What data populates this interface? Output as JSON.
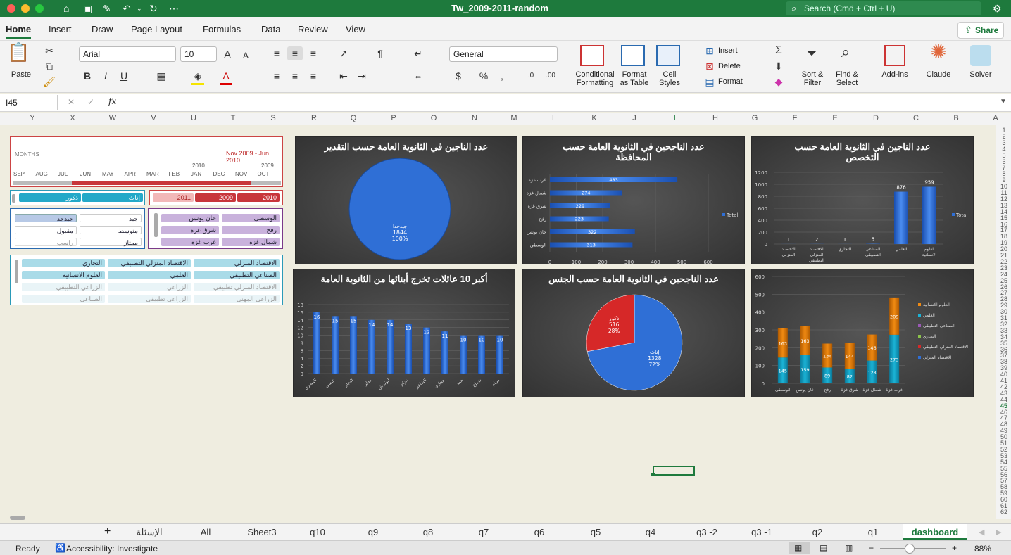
{
  "window": {
    "title": "Tw_2009-2011-random",
    "search_placeholder": "Search (Cmd + Ctrl + U)"
  },
  "tabs": [
    "Home",
    "Insert",
    "Draw",
    "Page Layout",
    "Formulas",
    "Data",
    "Review",
    "View"
  ],
  "share_label": "Share",
  "ribbon": {
    "paste": "Paste",
    "font": "Arial",
    "size": "10",
    "number_format": "General",
    "cond": "Conditional\nFormatting",
    "format_table": "Format\nas Table",
    "cell_styles": "Cell\nStyles",
    "insert": "Insert",
    "delete": "Delete",
    "format": "Format",
    "sort": "Sort &\nFilter",
    "find": "Find &\nSelect",
    "addins": "Add-ins",
    "claude": "Claude",
    "solver": "Solver"
  },
  "formula_bar": {
    "cell_ref": "I45",
    "fx": "fx"
  },
  "columns": [
    "Y",
    "X",
    "W",
    "V",
    "U",
    "T",
    "S",
    "R",
    "Q",
    "P",
    "O",
    "N",
    "M",
    "L",
    "K",
    "J",
    "I",
    "H",
    "G",
    "F",
    "E",
    "D",
    "C",
    "B",
    "A"
  ],
  "rows": [
    "1",
    "2",
    "3",
    "4",
    "5",
    "6",
    "7",
    "8",
    "9",
    "10",
    "11",
    "12",
    "13",
    "14",
    "15",
    "16",
    "17",
    "18",
    "19",
    "20",
    "21",
    "22",
    "23",
    "24",
    "25",
    "26",
    "27",
    "28",
    "29",
    "30",
    "31",
    "32",
    "33",
    "34",
    "35",
    "36",
    "37",
    "38",
    "39",
    "40",
    "41",
    "42",
    "43",
    "44",
    "45",
    "46",
    "47",
    "48",
    "49",
    "50",
    "51",
    "52",
    "53",
    "54",
    "55",
    "56",
    "57",
    "58",
    "59",
    "60",
    "61",
    "62"
  ],
  "timeline": {
    "label": "MONTHS",
    "range": "Nov 2009 - Jun 2010",
    "year_2010": "2010",
    "year_2009": "2009",
    "months": [
      "SEP",
      "AUG",
      "JUL",
      "JUN",
      "MAY",
      "APR",
      "MAR",
      "FEB",
      "JAN",
      "DEC",
      "NOV",
      "OCT"
    ]
  },
  "slicer_gender": [
    "إناث",
    "ذكور"
  ],
  "slicer_year": [
    "2011",
    "2009",
    "2010"
  ],
  "slicer_grade": [
    "جيدجدا",
    "جيد",
    "متوسط",
    "مقبول",
    "ممتاز",
    "راسب"
  ],
  "slicer_gov": [
    "الوسطى",
    "خان يونس",
    "رفح",
    "شرق غزة",
    "شمال غزة",
    "غرب غزة"
  ],
  "slicer_spec": [
    "الاقتصاد المنزلي",
    "الاقتصاد المنزلي التطبيقي",
    "التجاري",
    "الصناعي التطبيقي",
    "العلمي",
    "العلوم الانسانية",
    "الاقتصاد المنزلي تطبيقي",
    "الزراعي",
    "الزراعي التطبيقي",
    "الزراعي المهني",
    "الزراعي تطبيقي",
    "الصناعي"
  ],
  "chart_data": [
    {
      "id": "grade",
      "type": "pie",
      "title": "عدد الناجين في الثانوية العامة حسب التقدير",
      "categories": [
        "جيدجدا"
      ],
      "values": [
        1844
      ],
      "labels": [
        "1844",
        "100%"
      ],
      "colors": [
        "#2f6fd6"
      ]
    },
    {
      "id": "gov",
      "type": "bar",
      "title": "عدد الناجحين في الثانوية العامة حسب المحافظة",
      "categories": [
        "غرب غزة",
        "شمال غزة",
        "شرق غزة",
        "رفح",
        "خان يونس",
        "الوسطى"
      ],
      "values": [
        483,
        274,
        229,
        223,
        322,
        313
      ],
      "xlim": [
        0,
        600
      ],
      "xticks": [
        "0",
        "100",
        "200",
        "300",
        "400",
        "500",
        "600"
      ],
      "legend": "Total"
    },
    {
      "id": "spec",
      "type": "bar",
      "title": "عدد الناجين في الثانوية العامة حسب التخصص",
      "categories": [
        "الاقتصاد المنزلي",
        "الاقتصاد المنزلي التطبيقي",
        "التجاري",
        "الصناعي التطبيقي",
        "العلمي",
        "العلوم الانسانية"
      ],
      "values": [
        1,
        2,
        1,
        5,
        876,
        959
      ],
      "ylim": [
        0,
        1200
      ],
      "yticks": [
        "0",
        "200",
        "400",
        "600",
        "800",
        "1000",
        "1200"
      ],
      "legend": "Total"
    },
    {
      "id": "families",
      "type": "bar",
      "title": "أكبر 10 عائلات تخرج أبنائها من الثانوية العامة",
      "categories": [
        "المصري",
        "عيسى",
        "النجار",
        "مطر",
        "أبوكرش",
        "عزام",
        "الشاعر",
        "حجازي",
        "حمد",
        "شملخ",
        "صيام"
      ],
      "values": [
        16,
        15,
        15,
        14,
        14,
        13,
        12,
        11,
        10,
        10,
        10
      ],
      "ylim": [
        0,
        18
      ],
      "yticks": [
        "0",
        "2",
        "4",
        "6",
        "8",
        "10",
        "12",
        "14",
        "16",
        "18"
      ]
    },
    {
      "id": "gender",
      "type": "pie",
      "title": "عدد الناجحين في الثانوية العامة حسب الجنس",
      "categories": [
        "إناث",
        "ذكور"
      ],
      "values": [
        1328,
        516
      ],
      "labels": [
        [
          "إناث",
          "1328",
          "72%"
        ],
        [
          "ذكور",
          "516",
          "28%"
        ]
      ],
      "colors": [
        "#2f6fd6",
        "#d62828"
      ]
    },
    {
      "id": "stacked",
      "type": "bar",
      "title": "",
      "categories": [
        "الوسطى",
        "خان يونس",
        "رفح",
        "شرق غزة",
        "شمال غزة",
        "غرب غزة"
      ],
      "series": [
        {
          "name": "العلمي",
          "values": [
            145,
            159,
            89,
            82,
            128,
            273
          ],
          "color": "#1bb3d6"
        },
        {
          "name": "العلوم الانسانية",
          "values": [
            163,
            163,
            134,
            144,
            146,
            209
          ],
          "color": "#f08a12"
        }
      ],
      "legend": [
        "العلوم الانسانية",
        "العلمي",
        "الصناعي التطبيقي",
        "التجاري",
        "الاقتصاد المنزلي التطبيقي",
        "الاقتصاد المنزلي"
      ],
      "legend_colors": [
        "#f08a12",
        "#1bb3d6",
        "#9b59b6",
        "#8bc34a",
        "#d62828",
        "#2f6fd6"
      ],
      "ylim": [
        0,
        600
      ],
      "yticks": [
        "0",
        "100",
        "200",
        "300",
        "400",
        "500",
        "600"
      ]
    }
  ],
  "sheet_tabs": [
    "الإسئلة",
    "All",
    "Sheet3",
    "q10",
    "q9",
    "q8",
    "q7",
    "q6",
    "q5",
    "q4",
    "q3 -2",
    "q3 -1",
    "q2",
    "q1",
    "dashboard"
  ],
  "status": {
    "ready": "Ready",
    "accessibility": "Accessibility: Investigate",
    "zoom": "88%"
  }
}
